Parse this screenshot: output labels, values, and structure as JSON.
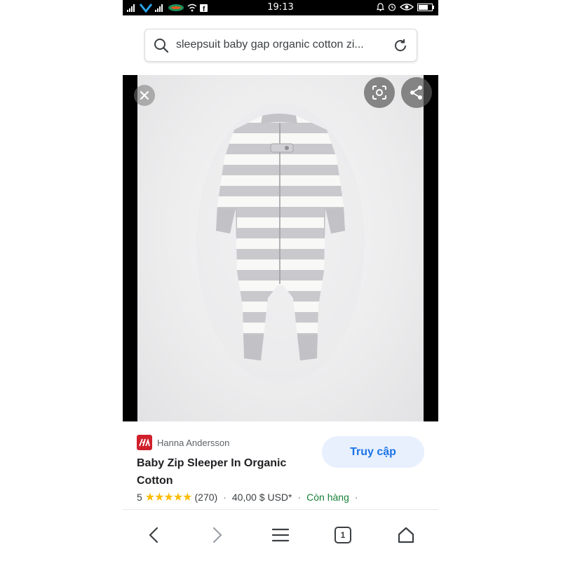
{
  "status_bar": {
    "time": "19:13",
    "left_icons": [
      "signal-icon",
      "network-logo-icon",
      "signal-icon",
      "carrier-logo-icon",
      "wifi-icon",
      "facebook-icon"
    ],
    "right_icons": [
      "alarm-icon",
      "clock-icon",
      "eye-icon",
      "battery-icon"
    ]
  },
  "search": {
    "query": "sleepsuit baby gap organic cotton zi...",
    "left_icon": "search-icon",
    "right_icon": "refresh-icon"
  },
  "image_viewer": {
    "subject": "grey and white striped baby zip sleeper",
    "buttons": [
      "close-icon",
      "lens-icon",
      "share-icon"
    ]
  },
  "result": {
    "source": "Hanna Andersson",
    "title": "Baby Zip Sleeper In Organic Cotton",
    "visit_label": "Truy cập",
    "rating": "5",
    "stars": "★★★★★",
    "reviews": "(270)",
    "separator": "·",
    "price": "40,00 $ USD*",
    "availability": "Còn hàng"
  },
  "nav": {
    "items": [
      "back-icon",
      "forward-icon",
      "menu-icon",
      "tabs-icon",
      "home-icon"
    ],
    "tab_count": "1"
  },
  "colors": {
    "accent": "#1a73e8",
    "visit_bg": "#e8f0fe",
    "star": "#fbbc04",
    "in_stock": "#188038",
    "brand_logo": "#d0202c"
  }
}
